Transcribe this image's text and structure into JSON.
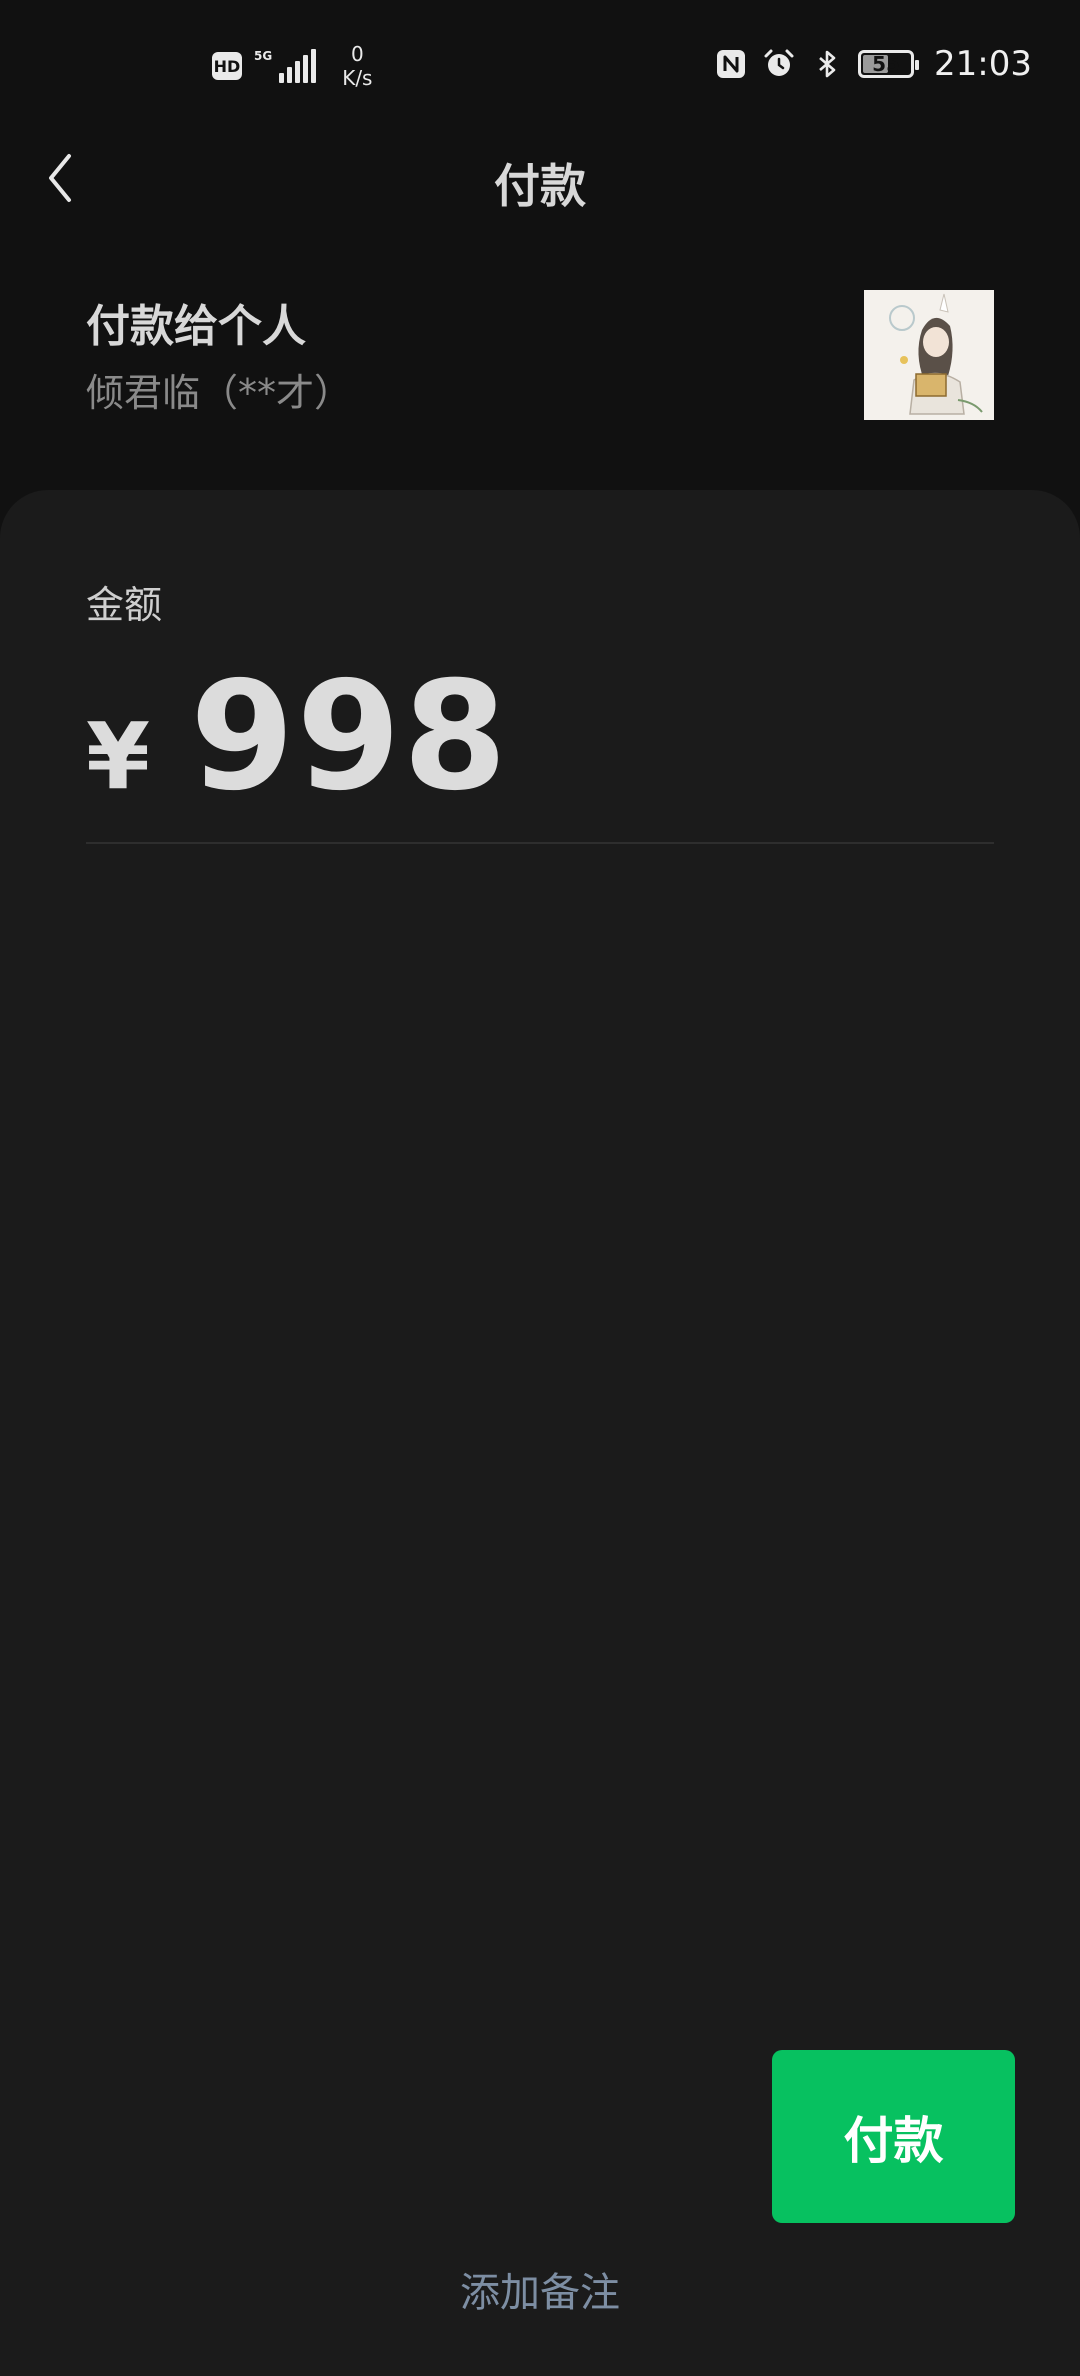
{
  "status_bar": {
    "hd_label": "HD",
    "network_gen": "5G",
    "net_speed_value": "0",
    "net_speed_unit": "K/s",
    "battery_percent": 55,
    "battery_text": "55",
    "time": "21:03",
    "icons": [
      "hd-icon",
      "signal-icon",
      "nfc-icon",
      "alarm-icon",
      "bluetooth-icon",
      "battery-icon"
    ]
  },
  "nav": {
    "back_icon": "chevron-left-icon",
    "title": "付款"
  },
  "payee": {
    "title": "付款给个人",
    "name": "倾君临（**才）",
    "avatar_icon": "user-avatar"
  },
  "amount": {
    "label": "金额",
    "currency_symbol": "¥",
    "value": "998"
  },
  "actions": {
    "pay_label": "付款",
    "add_note_label": "添加备注"
  },
  "colors": {
    "background": "#111111",
    "card": "#1b1b1b",
    "accent_green": "#07c160",
    "link": "#7d8ea3"
  }
}
